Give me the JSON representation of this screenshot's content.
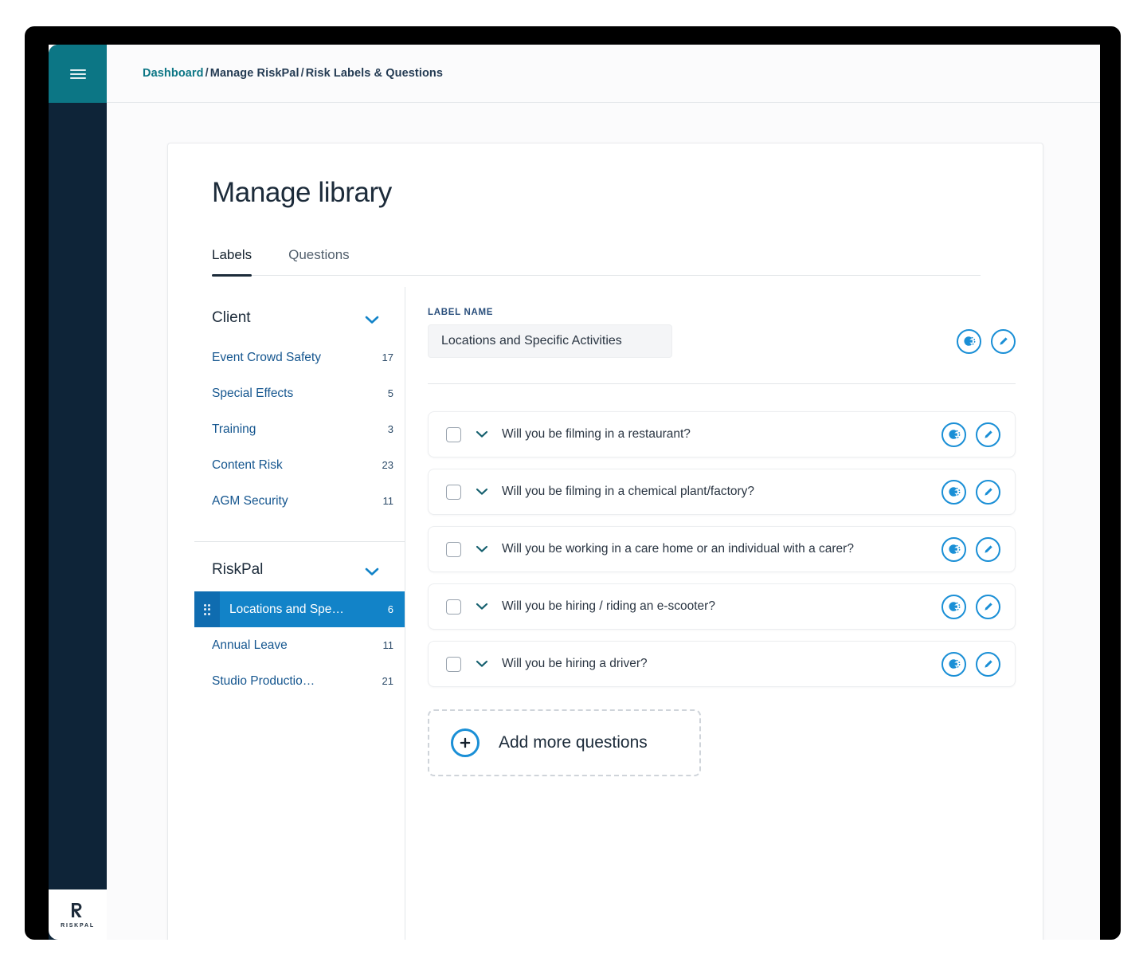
{
  "window": {
    "hamburger_icon": "hamburger-menu-icon",
    "logo_wordmark": "RISKPAL"
  },
  "breadcrumb": {
    "root": "Dashboard",
    "separator": "/",
    "level2": "Manage RiskPal",
    "level3": "Risk Labels & Questions"
  },
  "page": {
    "title": "Manage library"
  },
  "tabs": [
    {
      "label": "Labels",
      "active": true
    },
    {
      "label": "Questions",
      "active": false
    }
  ],
  "label_groups": [
    {
      "name": "Client",
      "expanded": true,
      "chevron_icon": "chevron-down-icon",
      "items": [
        {
          "name": "Event Crowd Safety",
          "count": "17",
          "selected": false
        },
        {
          "name": "Special Effects",
          "count": "5",
          "selected": false
        },
        {
          "name": "Training",
          "count": "3",
          "selected": false
        },
        {
          "name": "Content Risk",
          "count": "23",
          "selected": false
        },
        {
          "name": "AGM Security",
          "count": "11",
          "selected": false
        }
      ]
    },
    {
      "name": "RiskPal",
      "expanded": true,
      "chevron_icon": "chevron-down-icon",
      "items": [
        {
          "name": "Locations and Spe…",
          "count": "6",
          "selected": true
        },
        {
          "name": "Annual Leave",
          "count": "11",
          "selected": false
        },
        {
          "name": "Studio Productio…",
          "count": "21",
          "selected": false
        }
      ]
    }
  ],
  "detail": {
    "field_label": "LABEL NAME",
    "name_value": "Locations and Specific Activities",
    "name_placeholder": "Label name",
    "duplicate_icon": "duplicate-icon",
    "edit_icon": "pencil-edit-icon"
  },
  "questions": [
    {
      "text": "Will you be filming in a restaurant?",
      "checked": false
    },
    {
      "text": "Will you be filming in a chemical plant/factory?",
      "checked": false
    },
    {
      "text": "Will you be working in a care home or an individual with a carer?",
      "checked": false
    },
    {
      "text": "Will you be hiring / riding an e-scooter?",
      "checked": false
    },
    {
      "text": "Will you be hiring a driver?",
      "checked": false
    }
  ],
  "add_questions": {
    "label": "Add more questions",
    "icon": "plus-circle-icon"
  },
  "colors": {
    "teal": "#0c7685",
    "navy": "#0e2438",
    "blue": "#1283c8",
    "blue_dark": "#0f6cb0",
    "icon_blue": "#1a8fd6",
    "link_blue": "#15568f"
  }
}
